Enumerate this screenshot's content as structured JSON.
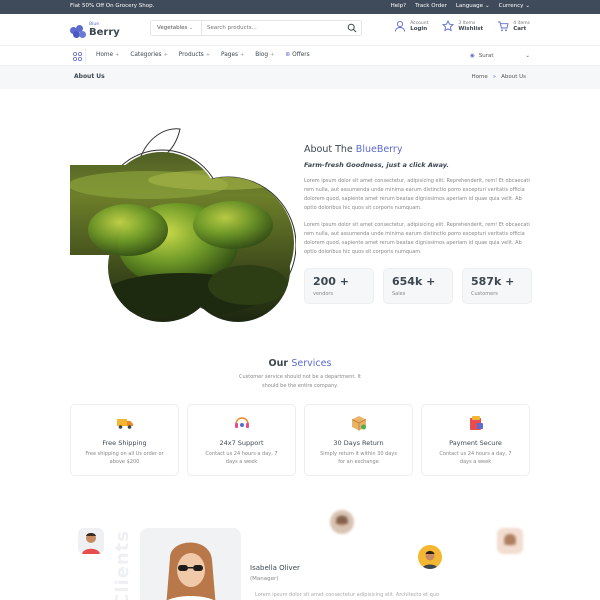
{
  "topbar": {
    "promo": "Flat 50% Off On Grocery Shop.",
    "links": [
      "Help?",
      "Track Order",
      "Language",
      "Currency"
    ]
  },
  "header": {
    "logo_small": "Blue",
    "logo": "Berry",
    "search": {
      "category": "Vegetables",
      "placeholder": "Search products..."
    },
    "account": {
      "line1": "Account",
      "line2": "Login"
    },
    "wishlist": {
      "line1": "3 Items",
      "line2": "Wishlist"
    },
    "cart": {
      "line1": "4 items",
      "line2": "Cart"
    }
  },
  "nav": {
    "items": [
      "Home",
      "Categories",
      "Products",
      "Pages",
      "Blog",
      "Offers"
    ],
    "location": "Surat"
  },
  "breadcrumb": {
    "title": "About Us",
    "home": "Home",
    "current": "About Us"
  },
  "about": {
    "title_prefix": "About The ",
    "title_accent": "BlueBerry",
    "tagline": "Farm-fresh Goodness, just a click Away.",
    "para1": "Lorem ipsum dolor sit amet consectetur, adipisicing elit. Reprehenderit, rem! Et obcaecati rem nulla, aut assumenda unde minima earum distinctio porro excepturi veritatis officia dolorem quod, sapiente amet rerum beatae dignissimos aperiam id quae quia velit. Ab optio doloribus hic quos sit corporis numquam.",
    "para2": "Lorem ipsum dolor sit amet consectetur, adipisicing elit. Reprehenderit, rem! Et obcaecati rem nulla, aut assumenda unde minima earum distinctio porro excepturi veritatis officia dolorem quod, sapiente amet rerum beatae dignissimos aperiam id quae quia velit. Ab optio doloribus hic quos sit corporis numquam.",
    "stats": [
      {
        "num": "200 +",
        "label": "vendors"
      },
      {
        "num": "654k +",
        "label": "Sales"
      },
      {
        "num": "587k +",
        "label": "Customers"
      }
    ]
  },
  "services": {
    "title_prefix": "Our ",
    "title_accent": "Services",
    "subtitle": "Customer service should not be a department. It should be the entire company.",
    "items": [
      {
        "title": "Free Shipping",
        "desc": "Free shipping on all Us order or above $200"
      },
      {
        "title": "24x7 Support",
        "desc": "Contact us 24 hours a day, 7 days a week"
      },
      {
        "title": "30 Days Return",
        "desc": "Simply return it within 30 days for an exchange"
      },
      {
        "title": "Payment Secure",
        "desc": "Contact us 24 hours a day, 7 days a week"
      }
    ]
  },
  "testimonial": {
    "vertical_label": "Clients",
    "name": "Isabella Oliver",
    "role": "(Manager)",
    "quote": "Lorem ipsum dolor sit amet consectetur adipisicing elit. Architecto et quo"
  },
  "colors": {
    "accent": "#5b6bcf",
    "dark": "#3d4750",
    "topbar": "#3f4a5a"
  }
}
